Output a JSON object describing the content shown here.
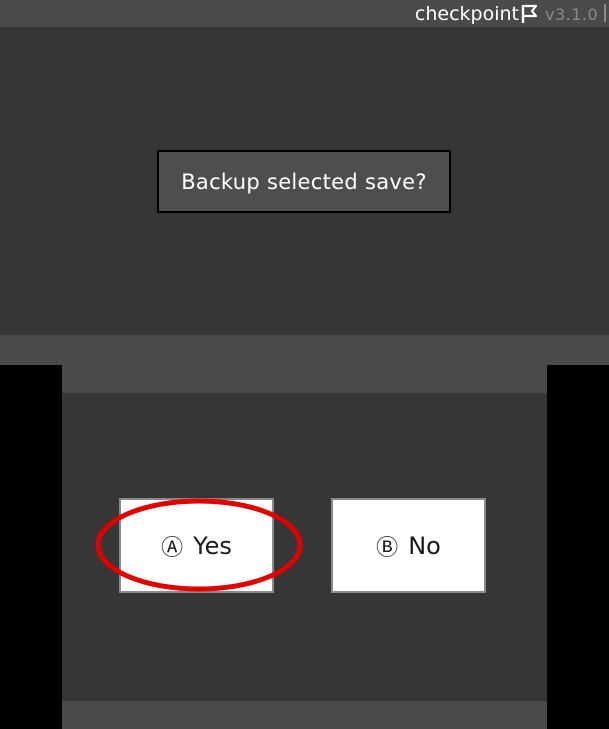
{
  "header": {
    "app_name": "checkpoint",
    "flag_icon": "flag-icon",
    "version": "v3.1.0"
  },
  "dialog": {
    "message": "Backup selected save?"
  },
  "buttons": {
    "yes": {
      "glyph": "Ⓐ",
      "label": "Yes"
    },
    "no": {
      "glyph": "Ⓑ",
      "label": "No"
    }
  },
  "annotation": {
    "highlight_color": "#e00000",
    "highlighted_button": "Yes"
  },
  "colors": {
    "panel": "#363636",
    "bar": "#4a4a4a",
    "dialog_bg": "#4e4e4e",
    "button_bg": "#ffffff"
  }
}
